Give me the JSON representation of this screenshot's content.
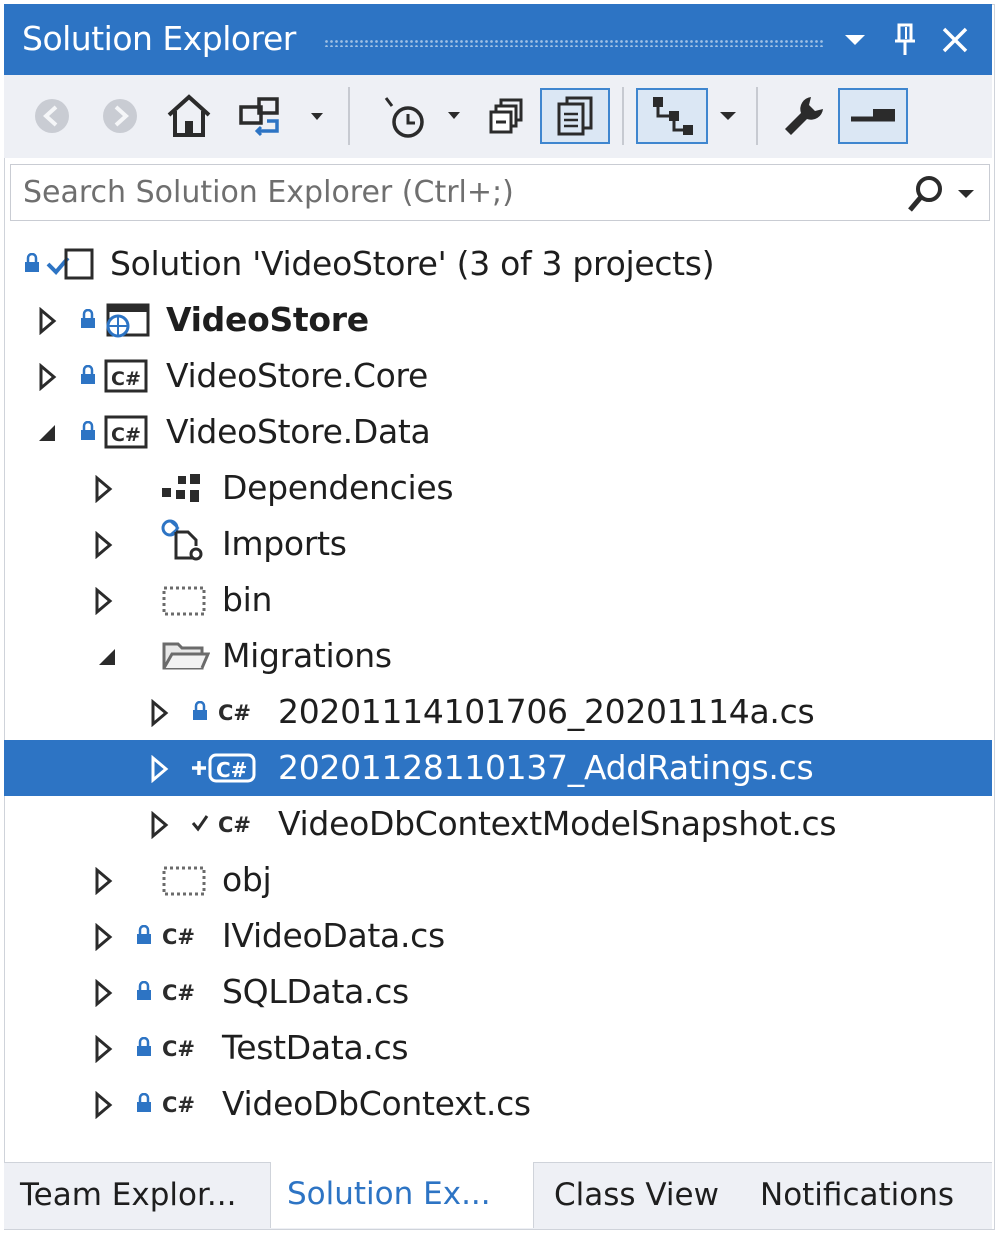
{
  "window": {
    "title": "Solution Explorer"
  },
  "toolbar": {
    "buttons": [
      "back-icon",
      "forward-icon",
      "home-icon",
      "switch-views-icon",
      "pending-changes-filter-icon",
      "collapse-all-icon",
      "show-all-files-icon",
      "sync-with-active-document-icon",
      "properties-icon",
      "preview-selected-items-icon"
    ]
  },
  "search": {
    "placeholder": "Search Solution Explorer (Ctrl+;)"
  },
  "tree": {
    "solution": "Solution 'VideoStore' (3 of 3 projects)",
    "items": [
      {
        "label": "VideoStore",
        "bold": true
      },
      {
        "label": "VideoStore.Core"
      },
      {
        "label": "VideoStore.Data"
      },
      {
        "label": "Dependencies"
      },
      {
        "label": "Imports"
      },
      {
        "label": "bin"
      },
      {
        "label": "Migrations"
      },
      {
        "label": "20201114101706_20201114a.cs"
      },
      {
        "label": "20201128110137_AddRatings.cs",
        "selected": true
      },
      {
        "label": "VideoDbContextModelSnapshot.cs"
      },
      {
        "label": "obj"
      },
      {
        "label": "IVideoData.cs"
      },
      {
        "label": "SQLData.cs"
      },
      {
        "label": "TestData.cs"
      },
      {
        "label": "VideoDbContext.cs"
      }
    ]
  },
  "tabs": [
    {
      "label": "Team Explor..."
    },
    {
      "label": "Solution Ex...",
      "active": true
    },
    {
      "label": "Class View"
    },
    {
      "label": "Notifications"
    }
  ],
  "colors": {
    "accent": "#2d74c4",
    "selection": "#2d74c4",
    "toolbar": "#eef0f5"
  }
}
